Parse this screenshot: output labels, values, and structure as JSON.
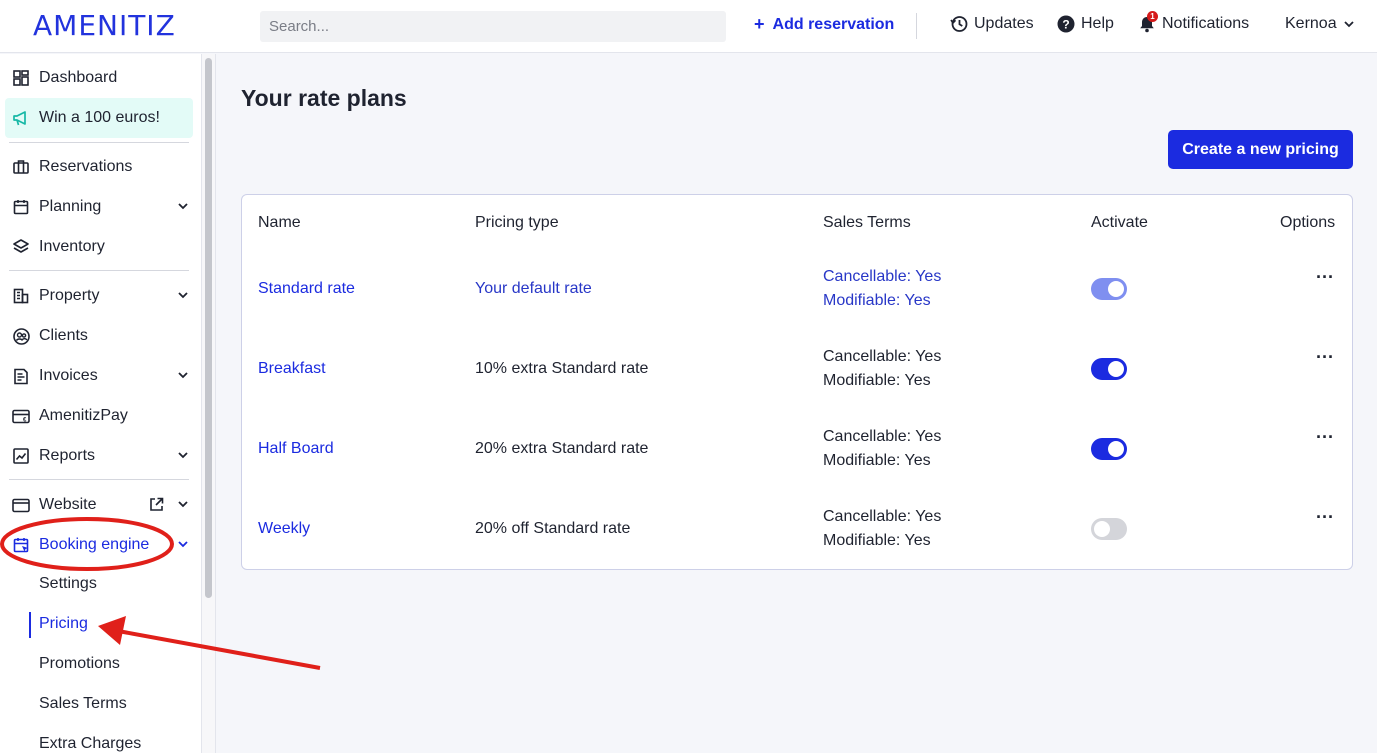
{
  "header": {
    "logo": "AMENITIZ",
    "search_placeholder": "Search...",
    "add_reservation": "Add reservation",
    "updates": "Updates",
    "help": "Help",
    "notifications": "Notifications",
    "notifications_count": "1",
    "user": "Kernoa"
  },
  "sidebar": {
    "items": [
      {
        "label": "Dashboard",
        "icon": "dashboard-icon"
      },
      {
        "label": "Win a 100 euros!",
        "icon": "megaphone-icon"
      },
      {
        "label": "Reservations",
        "icon": "suitcase-icon"
      },
      {
        "label": "Planning",
        "icon": "calendar-icon"
      },
      {
        "label": "Inventory",
        "icon": "layers-icon"
      },
      {
        "label": "Property",
        "icon": "building-icon"
      },
      {
        "label": "Clients",
        "icon": "clients-icon"
      },
      {
        "label": "Invoices",
        "icon": "invoice-icon"
      },
      {
        "label": "AmenitizPay",
        "icon": "card-icon"
      },
      {
        "label": "Reports",
        "icon": "chart-icon"
      },
      {
        "label": "Website",
        "icon": "browser-icon"
      },
      {
        "label": "Booking engine",
        "icon": "booking-engine-icon"
      }
    ],
    "sub_items": [
      "Settings",
      "Pricing",
      "Promotions",
      "Sales Terms",
      "Extra Charges"
    ],
    "active_sub": "Pricing"
  },
  "main": {
    "title": "Your rate plans",
    "create_button": "Create a new pricing",
    "columns": [
      "Name",
      "Pricing type",
      "Sales Terms",
      "Activate",
      "Options"
    ],
    "rows": [
      {
        "name": "Standard rate",
        "pricing_type": "Your default rate",
        "cancellable": "Cancellable: Yes",
        "modifiable": "Modifiable: Yes",
        "active": true,
        "options": "···"
      },
      {
        "name": "Breakfast",
        "pricing_type": "10% extra Standard rate",
        "cancellable": "Cancellable: Yes",
        "modifiable": "Modifiable: Yes",
        "active": true,
        "options": "···"
      },
      {
        "name": "Half Board",
        "pricing_type": "20% extra Standard rate",
        "cancellable": "Cancellable: Yes",
        "modifiable": "Modifiable: Yes",
        "active": true,
        "options": "···"
      },
      {
        "name": "Weekly",
        "pricing_type": "20% off Standard rate",
        "cancellable": "Cancellable: Yes",
        "modifiable": "Modifiable: Yes",
        "active": false,
        "options": "···"
      }
    ]
  },
  "colors": {
    "brand": "#1b2be0",
    "annotation": "#e0201a"
  }
}
